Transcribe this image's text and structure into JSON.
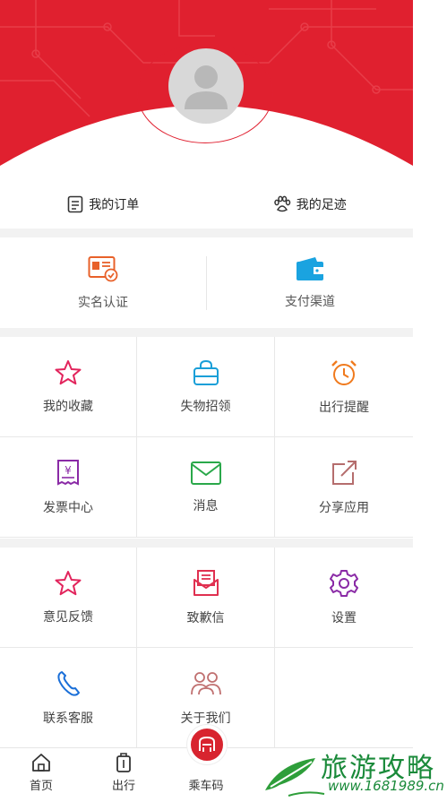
{
  "orders": {
    "my_orders": "我的订单",
    "my_footprints": "我的足迹"
  },
  "primary_actions": [
    {
      "label": "实名认证",
      "icon": "id-card-icon"
    },
    {
      "label": "支付渠道",
      "icon": "wallet-icon"
    }
  ],
  "grid_a": [
    {
      "label": "我的收藏",
      "icon": "star-icon",
      "color": "#e2245c"
    },
    {
      "label": "失物招领",
      "icon": "bag-icon",
      "color": "#1a9fd8"
    },
    {
      "label": "出行提醒",
      "icon": "alarm-clock-icon",
      "color": "#f07a1d"
    },
    {
      "label": "发票中心",
      "icon": "invoice-icon",
      "color": "#8a2aa6"
    },
    {
      "label": "消息",
      "icon": "envelope-icon",
      "color": "#2aa84a"
    },
    {
      "label": "分享应用",
      "icon": "share-icon",
      "color": "#b56d6d"
    }
  ],
  "grid_b": [
    {
      "label": "意见反馈",
      "icon": "star-outline-icon",
      "color": "#e2245c"
    },
    {
      "label": "致歉信",
      "icon": "apology-letter-icon",
      "color": "#e03050"
    },
    {
      "label": "设置",
      "icon": "gear-icon",
      "color": "#8a2aa6"
    },
    {
      "label": "联系客服",
      "icon": "phone-icon",
      "color": "#1a6fd8"
    },
    {
      "label": "关于我们",
      "icon": "people-icon",
      "color": "#c07070"
    }
  ],
  "tabbar": {
    "home": "首页",
    "travel": "出行",
    "ride_code": "乘车码"
  },
  "watermark": {
    "title": "旅游攻略",
    "url": "www.1681989.cn"
  },
  "colors": {
    "brand_red": "#e0202f",
    "divider": "#f2f2f2"
  }
}
